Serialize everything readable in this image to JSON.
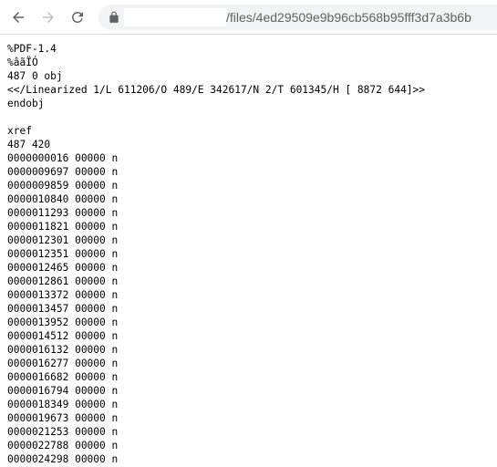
{
  "toolbar": {
    "url": "/files/4ed29509e9b96cb568b95fff3d7a3b6b"
  },
  "icons": {
    "back": "arrow-left-icon",
    "forward": "arrow-right-icon",
    "reload": "reload-icon",
    "lock": "lock-icon"
  },
  "document": {
    "lines": [
      "%PDF-1.4",
      "%âãÏÓ",
      "487 0 obj",
      "<</Linearized 1/L 611206/O 489/E 342617/N 2/T 601345/H [ 8872 644]>>",
      "endobj",
      "",
      "xref",
      "487 420",
      "0000000016 00000 n",
      "0000009697 00000 n",
      "0000009859 00000 n",
      "0000010840 00000 n",
      "0000011293 00000 n",
      "0000011821 00000 n",
      "0000012301 00000 n",
      "0000012351 00000 n",
      "0000012465 00000 n",
      "0000012861 00000 n",
      "0000013372 00000 n",
      "0000013457 00000 n",
      "0000013952 00000 n",
      "0000014512 00000 n",
      "0000016132 00000 n",
      "0000016277 00000 n",
      "0000016682 00000 n",
      "0000016794 00000 n",
      "0000018349 00000 n",
      "0000019673 00000 n",
      "0000021253 00000 n",
      "0000022788 00000 n",
      "0000024298 00000 n"
    ]
  }
}
